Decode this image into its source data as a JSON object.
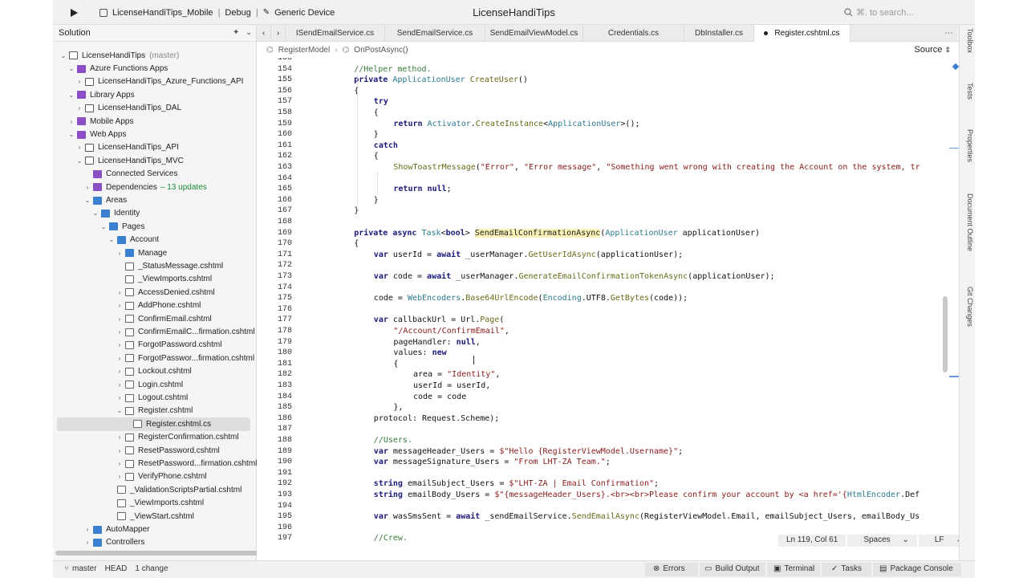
{
  "titlebar": {
    "project": "LicenseHandiTips_Mobile",
    "configuration": "Debug",
    "device": "Generic Device",
    "window_title": "LicenseHandiTips",
    "search_placeholder": "⌘. to search..."
  },
  "sidebar": {
    "title": "Solution",
    "items": [
      {
        "label": "LicenseHandiTips",
        "extra": "(master)",
        "depth": 0,
        "expanded": true,
        "icon": "solution"
      },
      {
        "label": "Azure Functions Apps",
        "depth": 1,
        "expanded": true,
        "icon": "folder-purple"
      },
      {
        "label": "LicenseHandiTips_Azure_Functions_API",
        "depth": 2,
        "expanded": false,
        "icon": "project"
      },
      {
        "label": "Library Apps",
        "depth": 1,
        "expanded": true,
        "icon": "folder-purple"
      },
      {
        "label": "LicenseHandiTips_DAL",
        "depth": 2,
        "expanded": false,
        "icon": "project"
      },
      {
        "label": "Mobile Apps",
        "depth": 1,
        "expanded": false,
        "icon": "folder-purple"
      },
      {
        "label": "Web Apps",
        "depth": 1,
        "expanded": true,
        "icon": "folder-purple"
      },
      {
        "label": "LicenseHandiTips_API",
        "depth": 2,
        "expanded": false,
        "icon": "project"
      },
      {
        "label": "LicenseHandiTips_MVC",
        "depth": 2,
        "expanded": true,
        "icon": "project"
      },
      {
        "label": "Connected Services",
        "depth": 3,
        "icon": "folder-purple"
      },
      {
        "label": "Dependencies",
        "extra": "– 13 updates",
        "depth": 3,
        "expanded": false,
        "icon": "folder-purple"
      },
      {
        "label": "Areas",
        "depth": 3,
        "expanded": true,
        "icon": "folder-blue"
      },
      {
        "label": "Identity",
        "depth": 4,
        "expanded": true,
        "icon": "folder-blue"
      },
      {
        "label": "Pages",
        "depth": 5,
        "expanded": true,
        "icon": "folder-blue"
      },
      {
        "label": "Account",
        "depth": 6,
        "expanded": true,
        "icon": "folder-blue"
      },
      {
        "label": "Manage",
        "depth": 7,
        "expanded": false,
        "icon": "folder-blue"
      },
      {
        "label": "_StatusMessage.cshtml",
        "depth": 7,
        "icon": "file"
      },
      {
        "label": "_ViewImports.cshtml",
        "depth": 7,
        "icon": "file"
      },
      {
        "label": "AccessDenied.cshtml",
        "depth": 7,
        "expanded": false,
        "icon": "file"
      },
      {
        "label": "AddPhone.cshtml",
        "depth": 7,
        "expanded": false,
        "icon": "file"
      },
      {
        "label": "ConfirmEmail.cshtml",
        "depth": 7,
        "expanded": false,
        "icon": "file"
      },
      {
        "label": "ConfirmEmailC...firmation.cshtml",
        "depth": 7,
        "expanded": false,
        "icon": "file"
      },
      {
        "label": "ForgotPassword.cshtml",
        "depth": 7,
        "expanded": false,
        "icon": "file"
      },
      {
        "label": "ForgotPasswor...firmation.cshtml",
        "depth": 7,
        "expanded": false,
        "icon": "file"
      },
      {
        "label": "Lockout.cshtml",
        "depth": 7,
        "expanded": false,
        "icon": "file"
      },
      {
        "label": "Login.cshtml",
        "depth": 7,
        "expanded": false,
        "icon": "file"
      },
      {
        "label": "Logout.cshtml",
        "depth": 7,
        "expanded": false,
        "icon": "file"
      },
      {
        "label": "Register.cshtml",
        "depth": 7,
        "expanded": true,
        "icon": "file"
      },
      {
        "label": "Register.cshtml.cs",
        "depth": 8,
        "icon": "file",
        "selected": true
      },
      {
        "label": "RegisterConfirmation.cshtml",
        "depth": 7,
        "expanded": false,
        "icon": "file"
      },
      {
        "label": "ResetPassword.cshtml",
        "depth": 7,
        "expanded": false,
        "icon": "file"
      },
      {
        "label": "ResetPassword...firmation.cshtml",
        "depth": 7,
        "expanded": false,
        "icon": "file"
      },
      {
        "label": "VerifyPhone.cshtml",
        "depth": 7,
        "expanded": false,
        "icon": "file"
      },
      {
        "label": "_ValidationScriptsPartial.cshtml",
        "depth": 6,
        "icon": "file"
      },
      {
        "label": "_ViewImports.cshtml",
        "depth": 6,
        "icon": "file"
      },
      {
        "label": "_ViewStart.cshtml",
        "depth": 6,
        "icon": "file"
      },
      {
        "label": "AutoMapper",
        "depth": 3,
        "expanded": false,
        "icon": "folder-blue"
      },
      {
        "label": "Controllers",
        "depth": 3,
        "expanded": false,
        "icon": "folder-blue"
      }
    ]
  },
  "tabs": [
    {
      "label": "ISendEmailService.cs"
    },
    {
      "label": "SendEmailService.cs"
    },
    {
      "label": "SendEmailViewModel.cs"
    },
    {
      "label": "Credentials.cs"
    },
    {
      "label": "DbInstaller.cs"
    },
    {
      "label": "Register.cshtml.cs",
      "active": true
    }
  ],
  "breadcrumbs": {
    "class": "RegisterModel",
    "method": "OnPostAsync()",
    "view_mode": "Source"
  },
  "code": {
    "lines": [
      {
        "n": "153",
        "tokens": []
      },
      {
        "n": "154",
        "indent": 2,
        "tokens": [
          [
            "cm",
            "//Helper method."
          ]
        ]
      },
      {
        "n": "155",
        "indent": 2,
        "tokens": [
          [
            "kw",
            "private "
          ],
          [
            "ty",
            "ApplicationUser "
          ],
          [
            "fn",
            "CreateUser"
          ],
          [
            "pl",
            "()"
          ]
        ]
      },
      {
        "n": "156",
        "indent": 2,
        "tokens": [
          [
            "pl",
            "{"
          ]
        ]
      },
      {
        "n": "157",
        "indent": 3,
        "tokens": [
          [
            "kw",
            "try"
          ]
        ]
      },
      {
        "n": "158",
        "indent": 3,
        "tokens": [
          [
            "pl",
            "{"
          ]
        ]
      },
      {
        "n": "159",
        "indent": 4,
        "tokens": [
          [
            "kw",
            "return "
          ],
          [
            "ty",
            "Activator"
          ],
          [
            "pl",
            "."
          ],
          [
            "fn",
            "CreateInstance"
          ],
          [
            "pl",
            "<"
          ],
          [
            "ty",
            "ApplicationUser"
          ],
          [
            "pl",
            ">();"
          ]
        ]
      },
      {
        "n": "160",
        "indent": 3,
        "tokens": [
          [
            "pl",
            "}"
          ]
        ]
      },
      {
        "n": "161",
        "indent": 3,
        "tokens": [
          [
            "kw",
            "catch"
          ]
        ]
      },
      {
        "n": "162",
        "indent": 3,
        "tokens": [
          [
            "pl",
            "{"
          ]
        ]
      },
      {
        "n": "163",
        "indent": 4,
        "tokens": [
          [
            "fn",
            "ShowToastrMessage"
          ],
          [
            "pl",
            "("
          ],
          [
            "str",
            "\"Error\""
          ],
          [
            "pl",
            ", "
          ],
          [
            "str",
            "\"Error message\""
          ],
          [
            "pl",
            ", "
          ],
          [
            "str",
            "\"Something went wrong with creating the Account on the system, tr"
          ]
        ]
      },
      {
        "n": "164",
        "tokens": []
      },
      {
        "n": "165",
        "indent": 4,
        "tokens": [
          [
            "kw",
            "return "
          ],
          [
            "kw",
            "null"
          ],
          [
            "pl",
            ";"
          ]
        ]
      },
      {
        "n": "166",
        "indent": 3,
        "tokens": [
          [
            "pl",
            "}"
          ]
        ]
      },
      {
        "n": "167",
        "indent": 2,
        "tokens": [
          [
            "pl",
            "}"
          ]
        ]
      },
      {
        "n": "168",
        "tokens": []
      },
      {
        "n": "169",
        "indent": 2,
        "tokens": [
          [
            "kw",
            "private async "
          ],
          [
            "ty",
            "Task"
          ],
          [
            "pl",
            "<"
          ],
          [
            "kw",
            "bool"
          ],
          [
            "pl",
            "> "
          ],
          [
            "hl",
            "SendEmailConfirmationAsync"
          ],
          [
            "pl",
            "("
          ],
          [
            "ty",
            "ApplicationUser "
          ],
          [
            "pl",
            "applicationUser)"
          ]
        ]
      },
      {
        "n": "170",
        "indent": 2,
        "tokens": [
          [
            "pl",
            "{"
          ]
        ]
      },
      {
        "n": "171",
        "indent": 3,
        "tokens": [
          [
            "kw",
            "var "
          ],
          [
            "pl",
            "userId = "
          ],
          [
            "kw",
            "await "
          ],
          [
            "pl",
            "_userManager."
          ],
          [
            "fn",
            "GetUserIdAsync"
          ],
          [
            "pl",
            "(applicationUser);"
          ]
        ]
      },
      {
        "n": "172",
        "tokens": []
      },
      {
        "n": "173",
        "indent": 3,
        "tokens": [
          [
            "kw",
            "var "
          ],
          [
            "pl",
            "code = "
          ],
          [
            "kw",
            "await "
          ],
          [
            "pl",
            "_userManager."
          ],
          [
            "fn",
            "GenerateEmailConfirmationTokenAsync"
          ],
          [
            "pl",
            "(applicationUser);"
          ]
        ]
      },
      {
        "n": "174",
        "tokens": []
      },
      {
        "n": "175",
        "indent": 3,
        "tokens": [
          [
            "pl",
            "code = "
          ],
          [
            "ty",
            "WebEncoders"
          ],
          [
            "pl",
            "."
          ],
          [
            "fn",
            "Base64UrlEncode"
          ],
          [
            "pl",
            "("
          ],
          [
            "ty",
            "Encoding"
          ],
          [
            "pl",
            ".UTF8."
          ],
          [
            "fn",
            "GetBytes"
          ],
          [
            "pl",
            "(code));"
          ]
        ]
      },
      {
        "n": "176",
        "tokens": []
      },
      {
        "n": "177",
        "indent": 3,
        "tokens": [
          [
            "kw",
            "var "
          ],
          [
            "pl",
            "callbackUrl = Url."
          ],
          [
            "fn",
            "Page"
          ],
          [
            "pl",
            "("
          ]
        ]
      },
      {
        "n": "178",
        "indent": 4,
        "tokens": [
          [
            "str",
            "\"/Account/ConfirmEmail\""
          ],
          [
            "pl",
            ","
          ]
        ]
      },
      {
        "n": "179",
        "indent": 4,
        "tokens": [
          [
            "pl",
            "pageHandler: "
          ],
          [
            "kw",
            "null"
          ],
          [
            "pl",
            ","
          ]
        ]
      },
      {
        "n": "180",
        "indent": 4,
        "tokens": [
          [
            "pl",
            "values: "
          ],
          [
            "kw",
            "new"
          ]
        ]
      },
      {
        "n": "181",
        "indent": 4,
        "tokens": [
          [
            "pl",
            "{"
          ]
        ]
      },
      {
        "n": "182",
        "indent": 5,
        "tokens": [
          [
            "pl",
            "area = "
          ],
          [
            "str",
            "\"Identity\""
          ],
          [
            "pl",
            ","
          ]
        ]
      },
      {
        "n": "183",
        "indent": 5,
        "tokens": [
          [
            "pl",
            "userId = userId,"
          ]
        ]
      },
      {
        "n": "184",
        "indent": 5,
        "tokens": [
          [
            "pl",
            "code = code"
          ]
        ]
      },
      {
        "n": "185",
        "indent": 4,
        "tokens": [
          [
            "pl",
            "},"
          ]
        ]
      },
      {
        "n": "186",
        "indent": 3,
        "tokens": [
          [
            "pl",
            "protocol: Request.Scheme);"
          ]
        ]
      },
      {
        "n": "187",
        "tokens": []
      },
      {
        "n": "188",
        "indent": 3,
        "tokens": [
          [
            "cm",
            "//Users."
          ]
        ]
      },
      {
        "n": "189",
        "indent": 3,
        "tokens": [
          [
            "kw",
            "var "
          ],
          [
            "pl",
            "messageHeader_Users = "
          ],
          [
            "str",
            "$\"Hello {RegisterViewModel.Username}\""
          ],
          [
            "pl",
            ";"
          ]
        ]
      },
      {
        "n": "190",
        "indent": 3,
        "tokens": [
          [
            "kw",
            "var "
          ],
          [
            "pl",
            "messageSignature_Users = "
          ],
          [
            "str",
            "\"From LHT-ZA Team.\""
          ],
          [
            "pl",
            ";"
          ]
        ]
      },
      {
        "n": "191",
        "tokens": []
      },
      {
        "n": "192",
        "indent": 3,
        "tokens": [
          [
            "kw",
            "string "
          ],
          [
            "pl",
            "emailSubject_Users = "
          ],
          [
            "str",
            "$\"LHT-ZA | Email Confirmation\""
          ],
          [
            "pl",
            ";"
          ]
        ]
      },
      {
        "n": "193",
        "indent": 3,
        "tokens": [
          [
            "kw",
            "string "
          ],
          [
            "pl",
            "emailBody_Users = "
          ],
          [
            "str",
            "$\"{messageHeader_Users}.<br><br>Please confirm your account by <a href='{"
          ],
          [
            "ty",
            "HtmlEncoder"
          ],
          [
            "pl",
            ".Def"
          ]
        ]
      },
      {
        "n": "194",
        "tokens": []
      },
      {
        "n": "195",
        "indent": 3,
        "tokens": [
          [
            "kw",
            "var "
          ],
          [
            "pl",
            "wasSmsSent = "
          ],
          [
            "kw",
            "await "
          ],
          [
            "pl",
            "_sendEmailService."
          ],
          [
            "fn",
            "SendEmailAsync"
          ],
          [
            "pl",
            "(RegisterViewModel.Email, emailSubject_Users, emailBody_Us"
          ]
        ]
      },
      {
        "n": "196",
        "tokens": []
      },
      {
        "n": "197",
        "indent": 3,
        "tokens": [
          [
            "cm",
            "//Crew."
          ]
        ]
      }
    ]
  },
  "editor_status": {
    "position": "Ln 119, Col 61",
    "indentation": "Spaces",
    "line_endings": "LF"
  },
  "right_panel": [
    "Toolbox",
    "Tests",
    "Properties",
    "Document Outline",
    "Git Changes"
  ],
  "statusbar": {
    "branch": "master",
    "head": "HEAD",
    "changes": "1 change",
    "errors": "Errors",
    "build_output": "Build Output",
    "terminal": "Terminal",
    "tasks": "Tasks",
    "package_console": "Package Console"
  }
}
